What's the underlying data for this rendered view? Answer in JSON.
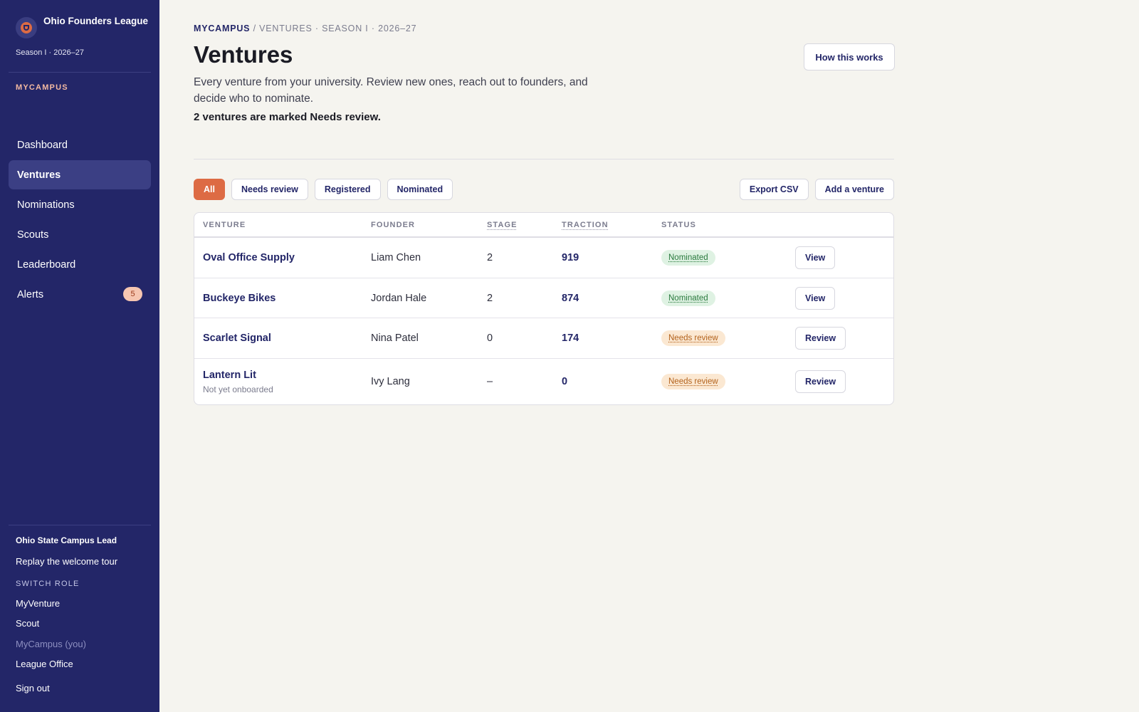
{
  "sidebar": {
    "brand_name": "Ohio Founders League",
    "season": "Season I · 2026–27",
    "section_label": "MYCAMPUS",
    "section_color": "#f2b9a1",
    "nav": [
      {
        "label": "Dashboard"
      },
      {
        "label": "Ventures"
      },
      {
        "label": "Nominations"
      },
      {
        "label": "Scouts"
      },
      {
        "label": "Leaderboard"
      },
      {
        "label": "Alerts",
        "badge": "5"
      }
    ],
    "footer": {
      "user_role": "Ohio State Campus Lead",
      "replay_tour": "Replay the welcome tour",
      "switch_role_label": "SWITCH ROLE",
      "roles": [
        "MyVenture",
        "Scout",
        "MyCampus (you)",
        "League Office"
      ],
      "sign_out": "Sign out"
    }
  },
  "header": {
    "breadcrumb_root": "MYCAMPUS",
    "breadcrumb_rest": " / VENTURES · SEASON I · 2026–27",
    "title": "Ventures",
    "description": "Every venture from your university. Review new ones, reach out to founders, and decide who to nominate.",
    "review_note": "2 ventures are marked Needs review.",
    "how_button": "How this works"
  },
  "filters": {
    "chips": [
      "All",
      "Needs review",
      "Registered",
      "Nominated"
    ],
    "active": "All",
    "accent_color": "#dd6b44"
  },
  "actions": {
    "export": "Export CSV",
    "add": "Add a venture"
  },
  "table": {
    "columns": [
      "VENTURE",
      "FOUNDER",
      "STAGE",
      "TRACTION",
      "STATUS"
    ],
    "rows": [
      {
        "venture": "Oval Office Supply",
        "sub": "",
        "founder": "Liam Chen",
        "stage": "2",
        "traction": "919",
        "status": "Nominated",
        "action": "View"
      },
      {
        "venture": "Buckeye Bikes",
        "sub": "",
        "founder": "Jordan Hale",
        "stage": "2",
        "traction": "874",
        "status": "Nominated",
        "action": "View"
      },
      {
        "venture": "Scarlet Signal",
        "sub": "",
        "founder": "Nina Patel",
        "stage": "0",
        "traction": "174",
        "status": "Needs review",
        "action": "Review"
      },
      {
        "venture": "Lantern Lit",
        "sub": "Not yet onboarded",
        "founder": "Ivy Lang",
        "stage": "–",
        "traction": "0",
        "status": "Needs review",
        "action": "Review"
      }
    ]
  }
}
